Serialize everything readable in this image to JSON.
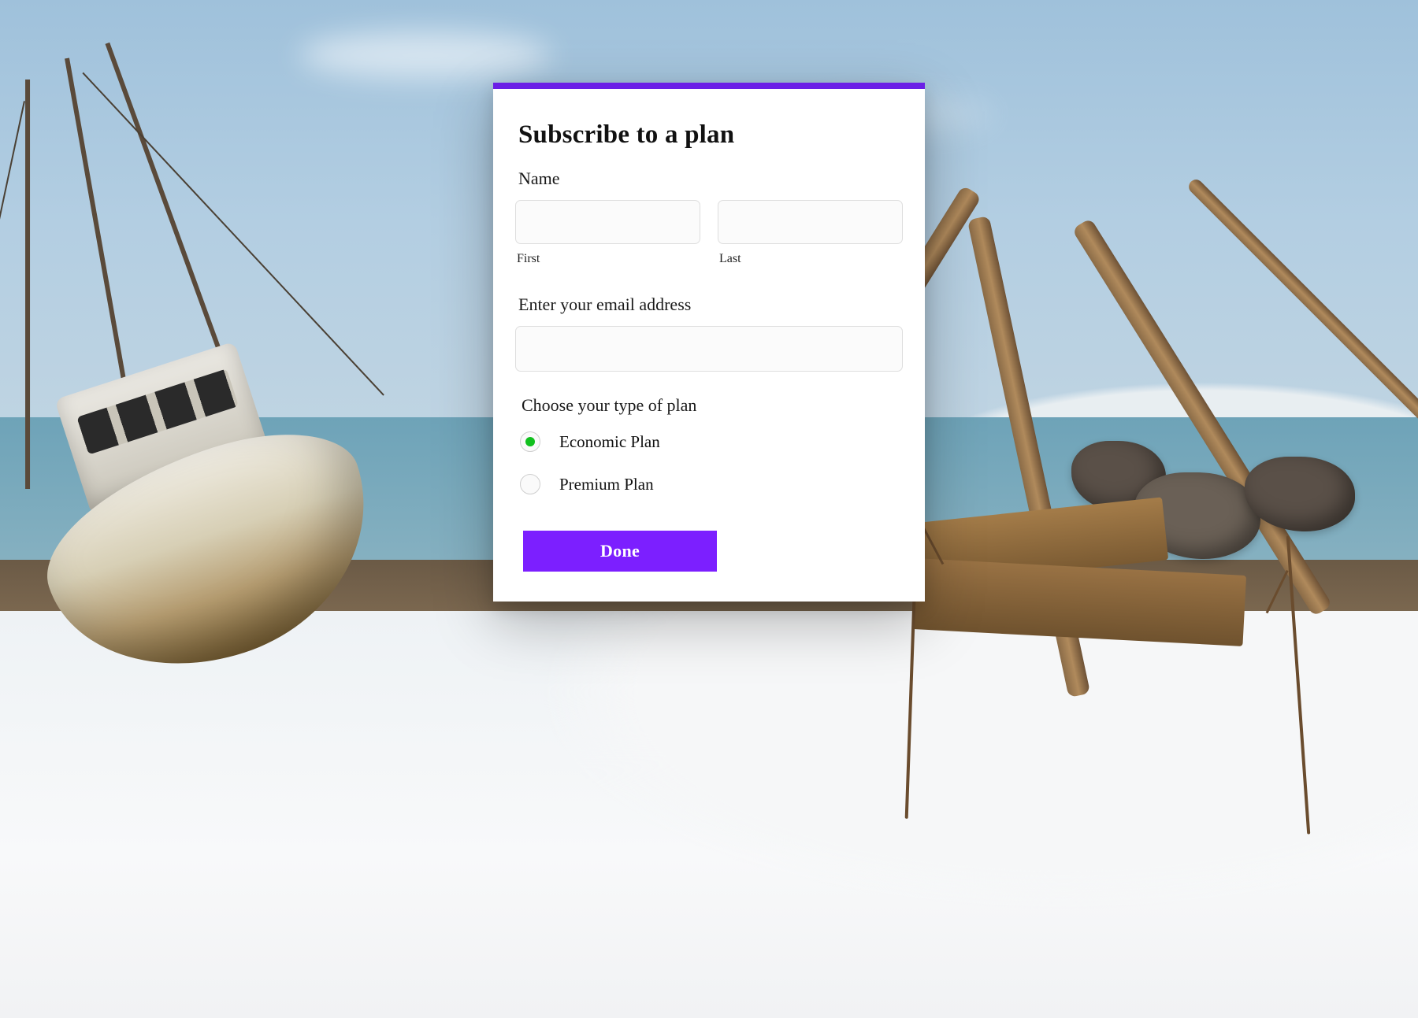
{
  "form": {
    "title": "Subscribe to a plan",
    "name": {
      "label": "Name",
      "first": {
        "sub_label": "First",
        "value": ""
      },
      "last": {
        "sub_label": "Last",
        "value": ""
      }
    },
    "email": {
      "label": "Enter your email address",
      "value": ""
    },
    "plan": {
      "heading": "Choose your type of plan",
      "options": [
        {
          "label": "Economic Plan",
          "selected": true
        },
        {
          "label": "Premium Plan",
          "selected": false
        }
      ]
    },
    "submit_label": "Done"
  },
  "colors": {
    "accent": "#6b1fe6",
    "button": "#7c1fff",
    "radio_selected": "#11c01e"
  }
}
